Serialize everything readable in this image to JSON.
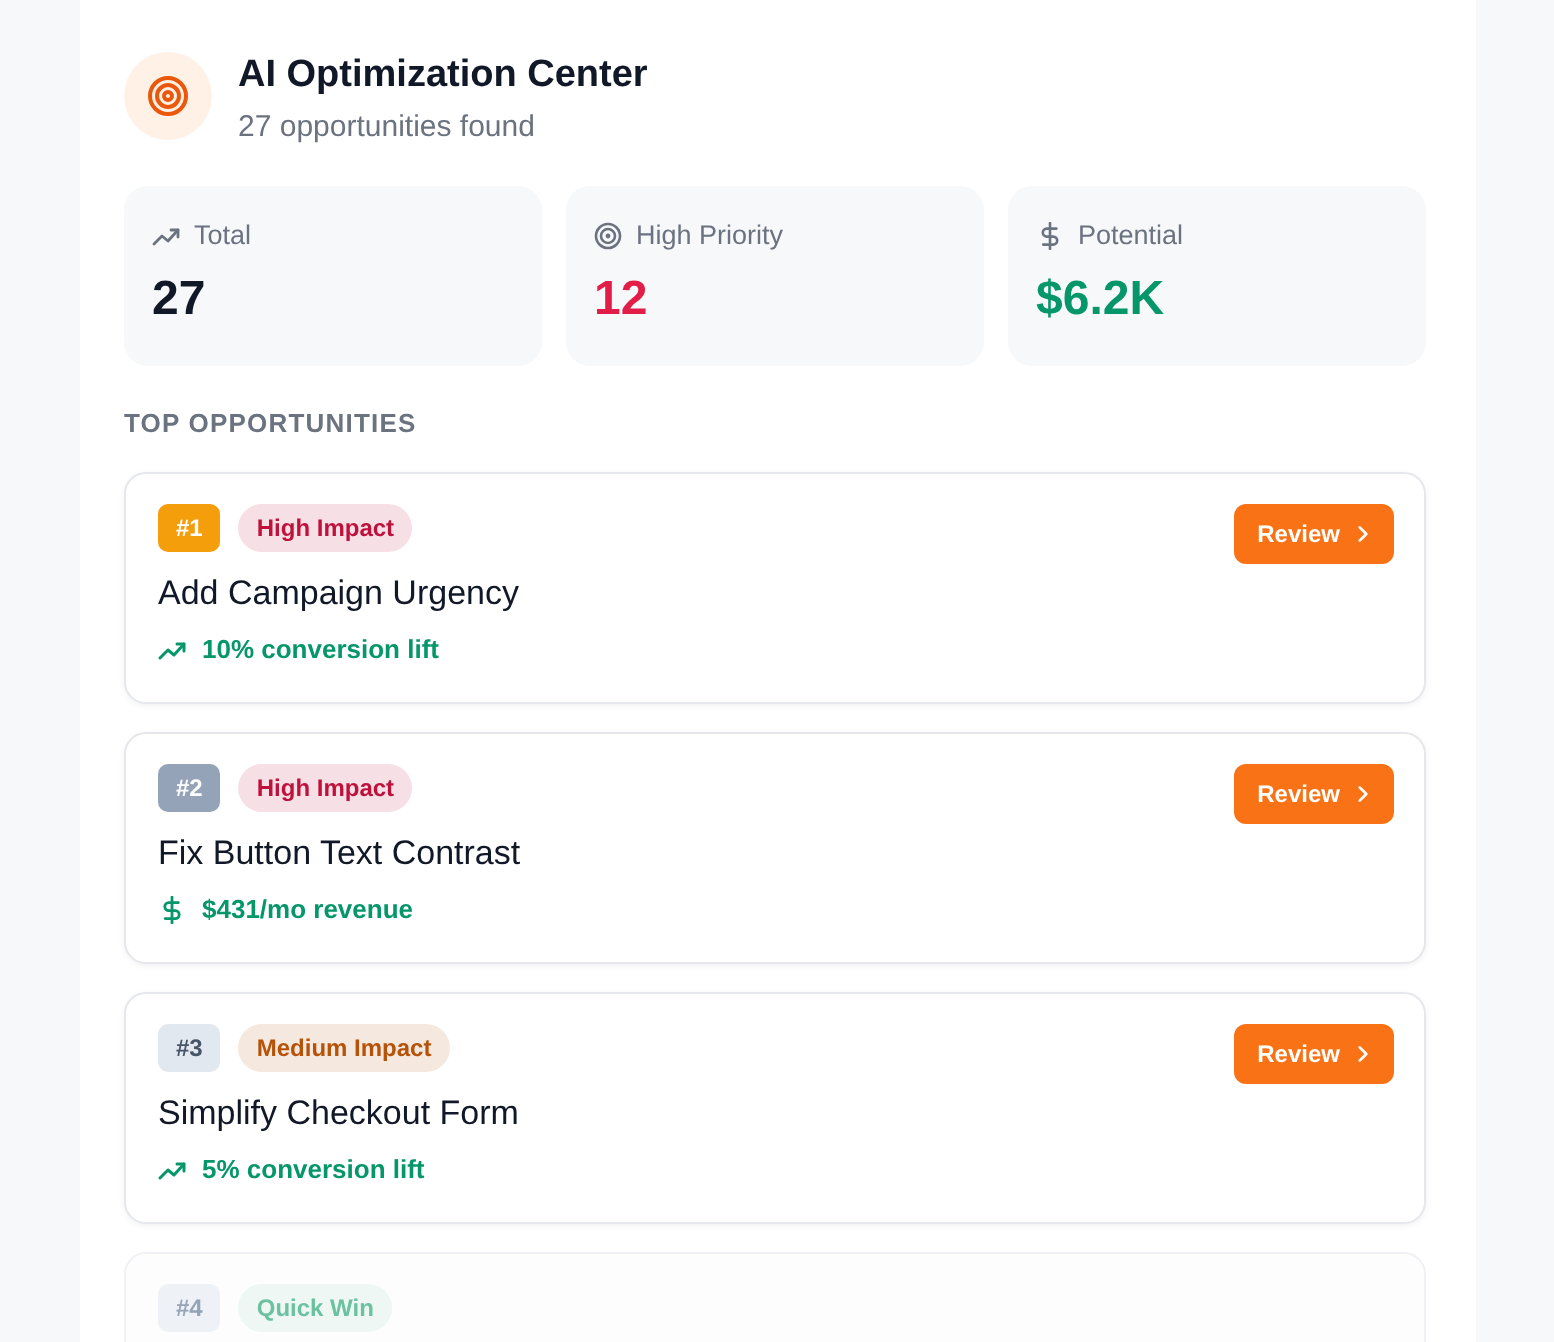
{
  "header": {
    "title": "AI Optimization Center",
    "subtitle": "27 opportunities found"
  },
  "stats": [
    {
      "kind": "total",
      "label": "Total",
      "value": "27"
    },
    {
      "kind": "priority",
      "label": "High Priority",
      "value": "12"
    },
    {
      "kind": "potential",
      "label": "Potential",
      "value": "$6.2K"
    }
  ],
  "section_title": "TOP OPPORTUNITIES",
  "opportunities": [
    {
      "rank": {
        "text": "#1",
        "color": "#f59e0b"
      },
      "impact": {
        "text": "High Impact",
        "color": "#be123c"
      },
      "title": "Add Campaign Urgency",
      "metric": {
        "kind": "trend",
        "text": "10% conversion lift"
      },
      "action": "Review",
      "dimmed": false
    },
    {
      "rank": {
        "text": "#2",
        "color": "#94a3b8"
      },
      "impact": {
        "text": "High Impact",
        "color": "#be123c"
      },
      "title": "Fix Button Text Contrast",
      "metric": {
        "kind": "revenue",
        "text": "$431/mo revenue"
      },
      "action": "Review",
      "dimmed": false
    },
    {
      "rank": {
        "text": "#3",
        "color": "#e2e8f0"
      },
      "impact": {
        "text": "Medium Impact",
        "color": "#b45309"
      },
      "title": "Simplify Checkout Form",
      "metric": {
        "kind": "trend",
        "text": "5% conversion lift"
      },
      "action": "Review",
      "dimmed": false
    },
    {
      "rank": {
        "text": "#4",
        "color": "#eef1f5"
      },
      "impact": {
        "text": "Quick Win",
        "color": "#6cc2a0"
      },
      "dimmed": true
    }
  ]
}
